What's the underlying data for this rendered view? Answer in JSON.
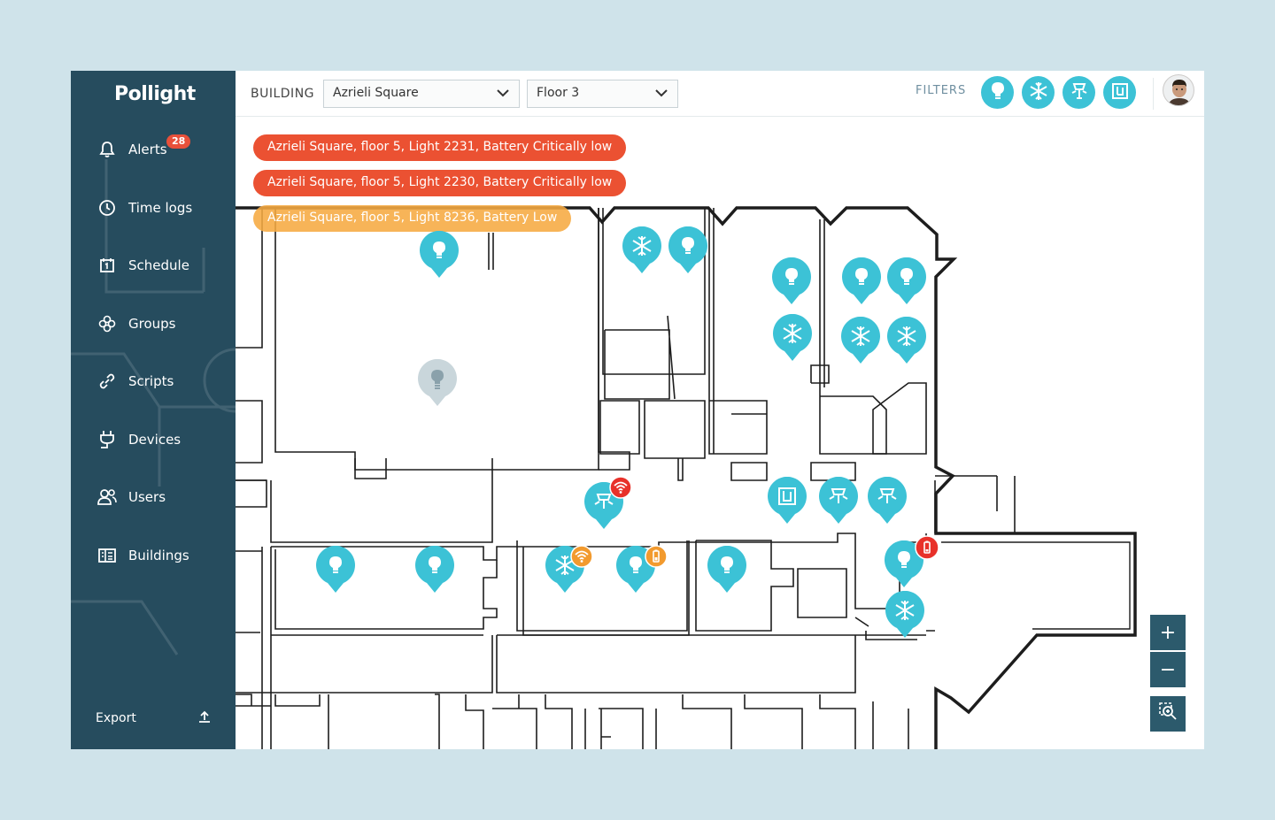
{
  "app": {
    "logo": "Pollight"
  },
  "sidebar": {
    "items": [
      {
        "label": "Alerts",
        "icon": "bell-icon",
        "badge": "28"
      },
      {
        "label": "Time logs",
        "icon": "clock-icon"
      },
      {
        "label": "Schedule",
        "icon": "calendar-icon"
      },
      {
        "label": "Groups",
        "icon": "groups-icon"
      },
      {
        "label": "Scripts",
        "icon": "link-icon"
      },
      {
        "label": "Devices",
        "icon": "plug-icon"
      },
      {
        "label": "Users",
        "icon": "users-icon"
      },
      {
        "label": "Buildings",
        "icon": "building-icon"
      }
    ],
    "export_label": "Export"
  },
  "topbar": {
    "building_label": "BUILDING",
    "building_select": "Azrieli Square",
    "floor_select": "Floor 3",
    "filters_label": "FILTERS",
    "filters": [
      "bulb-icon",
      "snowflake-icon",
      "sensor-icon",
      "panel-icon"
    ]
  },
  "alerts": [
    {
      "text": "Azrieli Square, floor 5, Light 2231, Battery Critically low",
      "severity": "critical"
    },
    {
      "text": "Azrieli Square, floor 5, Light 2230, Battery Critically low",
      "severity": "critical"
    },
    {
      "text": "Azrieli Square, floor 5, Light 8236, Battery Low",
      "severity": "low"
    }
  ],
  "zoom": {
    "in": "+",
    "out": "−"
  },
  "colors": {
    "sidebar": "#264c5e",
    "accent": "#3cc2d6",
    "critical": "#eb5132",
    "warning": "#f29a2e",
    "inactive_pin": "#c9d6db"
  }
}
